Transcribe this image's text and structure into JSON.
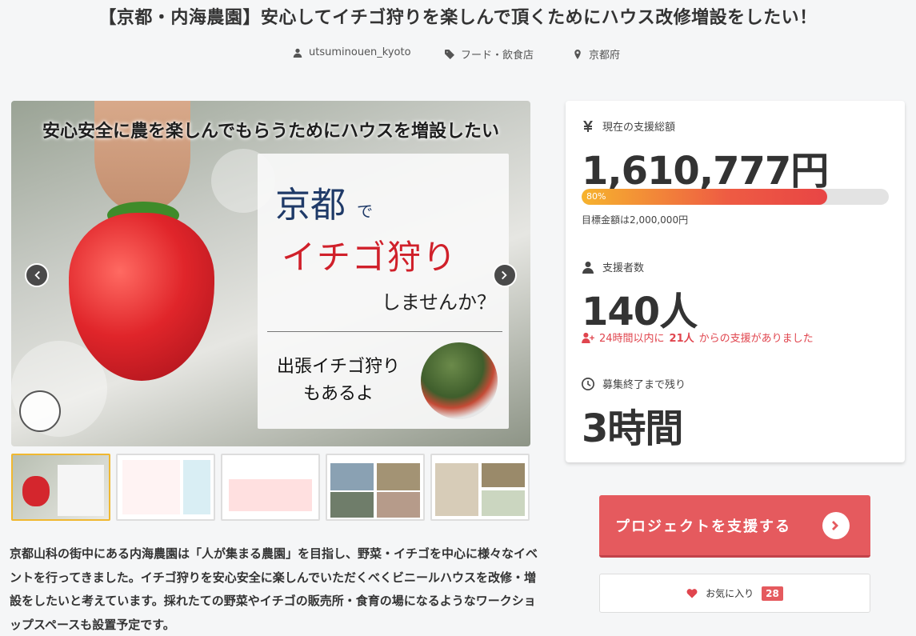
{
  "project": {
    "title": "【京都・内海農園】安心してイチゴ狩りを楽しんで頂くためにハウス改修増設をしたい！",
    "owner": "utsuminouen_kyoto",
    "category": "フード・飲食店",
    "location": "京都府",
    "description": "京都山科の街中にある内海農園は「人が集まる農園」を目指し、野菜・イチゴを中心に様々なイベントを行ってきました。イチゴ狩りを安心安全に楽しんでいただくべくビニールハウスを改修・増設をしたいと考えています。採れたての野菜やイチゴの販売所・食育の場になるようなワークショップスペースも設置予定です。"
  },
  "hero": {
    "banner": "安心安全に農を楽しんでもらうためにハウスを増設したい",
    "line1": "京都",
    "line1_suffix": "で",
    "line2": "イチゴ狩り",
    "line3": "しませんか？",
    "line4a": "出張イチゴ狩り",
    "line4b": "もあるよ"
  },
  "thumbnails": [
    {
      "name": "thumb-1",
      "active": true
    },
    {
      "name": "thumb-2",
      "active": false
    },
    {
      "name": "thumb-3",
      "active": false
    },
    {
      "name": "thumb-4",
      "active": false
    },
    {
      "name": "thumb-5",
      "active": false
    }
  ],
  "stats": {
    "amount_label": "現在の支援総額",
    "amount": "1,610,777円",
    "progress_percent": 80,
    "progress_label": "80%",
    "goal_text": "目標金額は2,000,000円",
    "supporters_label": "支援者数",
    "supporters": "140人",
    "recent_prefix": "24時間以内に",
    "recent_count": "21人",
    "recent_suffix": "からの支援がありました",
    "remaining_label": "募集終了まで残り",
    "remaining": "3時間"
  },
  "actions": {
    "support_label": "プロジェクトを支援する",
    "favorite_label": "お気に入り",
    "favorite_count": "28"
  },
  "colors": {
    "accent": "#e55a5e",
    "progress_start": "#f6b32e",
    "progress_end": "#e84545",
    "recent_text": "#e0454e",
    "active_thumb_border": "#f0b830"
  },
  "icons": [
    "user-icon",
    "tag-icon",
    "map-pin-icon",
    "yen-icon",
    "person-icon",
    "user-plus-icon",
    "clock-icon",
    "chevron-left-icon",
    "chevron-right-icon",
    "heart-icon"
  ]
}
